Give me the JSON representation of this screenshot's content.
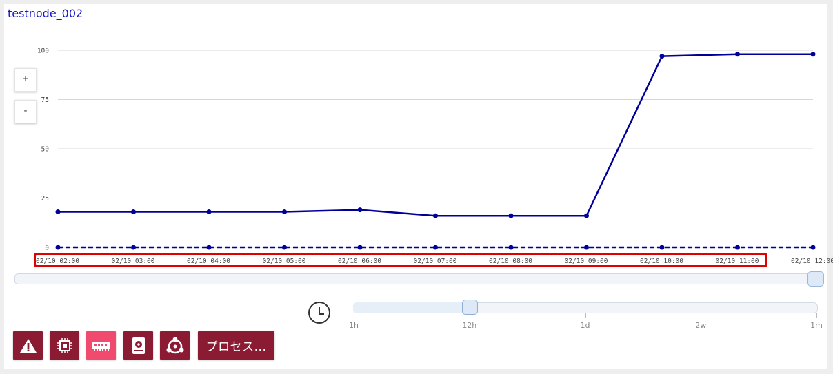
{
  "node_title": "testnode_002",
  "zoom": {
    "in_label": "+",
    "out_label": "-"
  },
  "chart_data": {
    "type": "line",
    "ylim": [
      0,
      100
    ],
    "y_ticks": [
      "0",
      "25",
      "50",
      "75",
      "100"
    ],
    "x_labels": [
      "02/10 02:00",
      "02/10 03:00",
      "02/10 04:00",
      "02/10 05:00",
      "02/10 06:00",
      "02/10 07:00",
      "02/10 08:00",
      "02/10 09:00",
      "02/10 10:00",
      "02/10 11:00",
      "02/10 12:00"
    ],
    "series": [
      {
        "style": "solid",
        "color": "#000099",
        "values": [
          18,
          18,
          18,
          18,
          19,
          16,
          16,
          16,
          97,
          98,
          98
        ]
      },
      {
        "style": "dashed",
        "color": "#000099",
        "values": [
          0,
          0,
          0,
          0,
          0,
          0,
          0,
          0,
          0,
          0,
          0
        ]
      }
    ],
    "grid": true
  },
  "time_range": {
    "labels": [
      "1h",
      "12h",
      "1d",
      "2w",
      "1m"
    ],
    "selected": "12h"
  },
  "toolbar": {
    "buttons": [
      {
        "icon": "alert-icon",
        "active": false
      },
      {
        "icon": "cpu-icon",
        "active": false
      },
      {
        "icon": "memory-icon",
        "active": true
      },
      {
        "icon": "disk-icon",
        "active": false
      },
      {
        "icon": "network-icon",
        "active": false
      }
    ],
    "process_label": "プロセス..."
  },
  "colors": {
    "accent": "#8b1a33",
    "active": "#f04a6e",
    "highlight": "#e00000",
    "line": "#000099"
  }
}
